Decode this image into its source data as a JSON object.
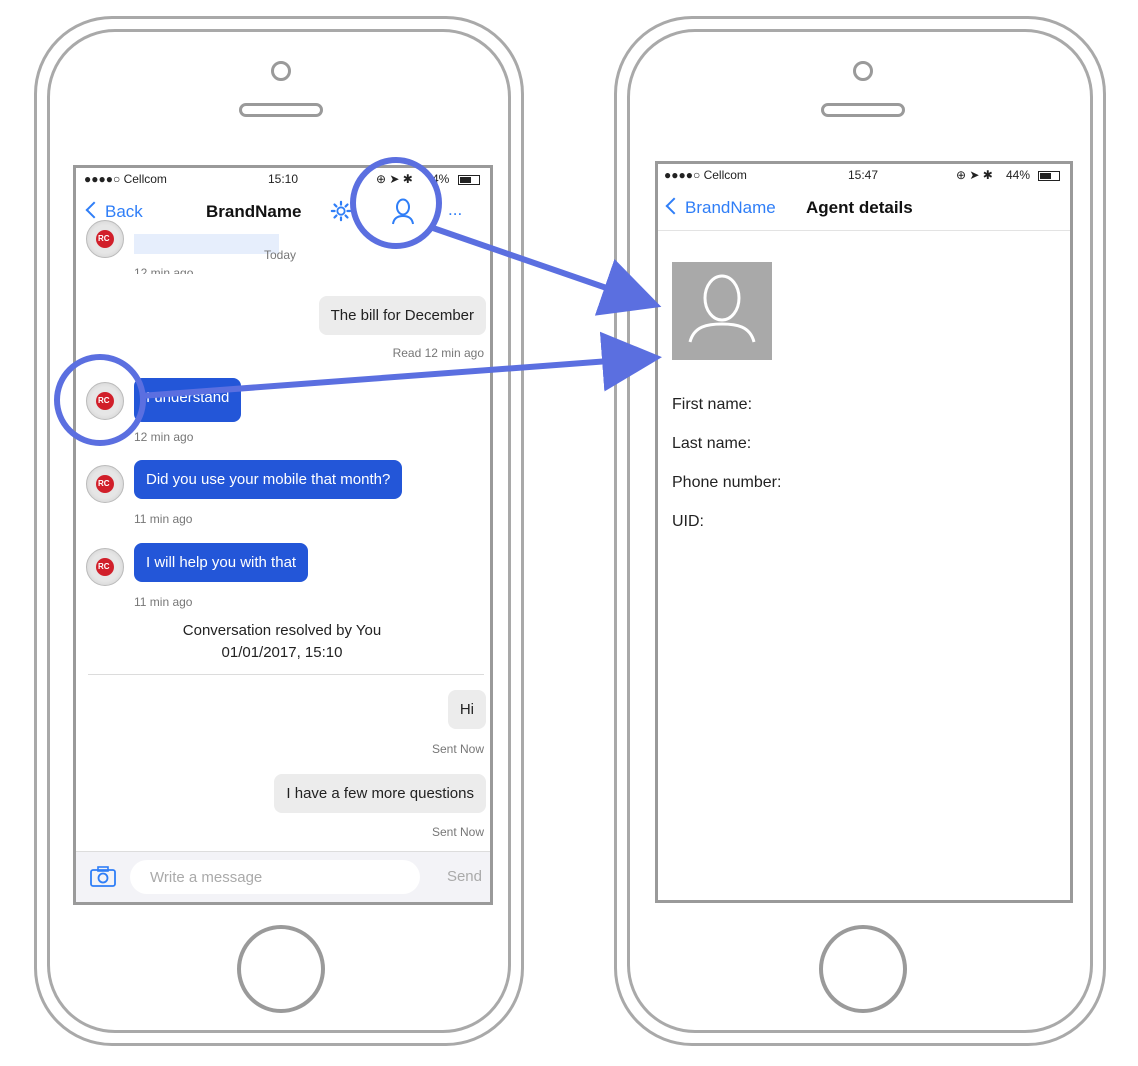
{
  "left_phone": {
    "status": {
      "carrier": "●●●●○ Cellcom",
      "time": "15:10",
      "battery": "4%"
    },
    "nav": {
      "back_label": "Back",
      "title": "BrandName",
      "more_label": "..."
    },
    "messages": {
      "partial_meta_today": "Today",
      "partial_meta_ago": "12 min ago",
      "out1_text": "The bill for December",
      "out1_meta": "Read  12 min ago",
      "in1_text": "I understand",
      "in1_meta": "12 min ago",
      "in2_text": "Did you use your mobile that month?",
      "in2_meta": "11 min ago",
      "in3_text": "I will help you with that",
      "in3_meta": "11 min ago",
      "resolved_line1": "Conversation resolved by You",
      "resolved_line2": "01/01/2017, 15:10",
      "out2_text": "Hi",
      "out2_meta": "Sent  Now",
      "out3_text": "I have a few more questions",
      "out3_meta": "Sent  Now"
    },
    "input": {
      "placeholder": "Write a message",
      "send_label": "Send"
    }
  },
  "right_phone": {
    "status": {
      "carrier": "●●●●○ Cellcom",
      "time": "15:47",
      "battery": "44%"
    },
    "nav": {
      "back_label": "BrandName",
      "title": "Agent details"
    },
    "fields": {
      "first_name": "First name:",
      "last_name": "Last name:",
      "phone_number": "Phone number:",
      "uid": "UID:"
    }
  },
  "colors": {
    "accent": "#2f7ef7",
    "annotation": "#5b6fe0",
    "agent_bubble": "#2356d8"
  }
}
